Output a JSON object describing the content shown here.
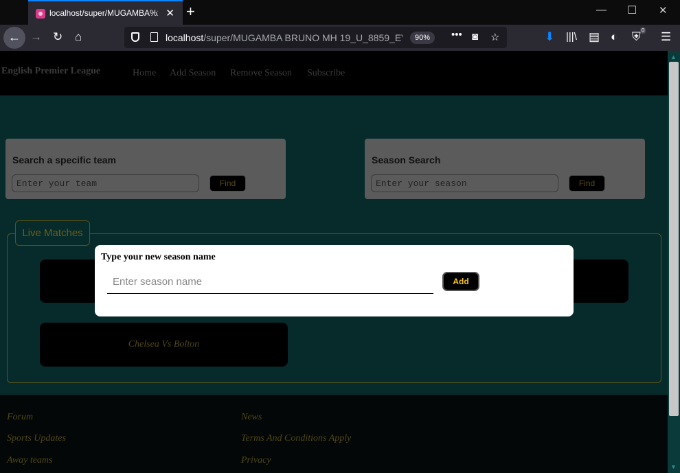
{
  "browser": {
    "tab_title": "localhost/super/MUGAMBA%2",
    "url_host": "localhost",
    "url_path": "/super/MUGAMBA BRUNO MH 19_U_8859_EV",
    "zoom": "90%",
    "badge_count": "0"
  },
  "site": {
    "brand": "English Premier League",
    "nav": [
      "Home",
      "Add Season",
      "Remove Season",
      "Subscribe"
    ]
  },
  "team_search": {
    "label": "Search a specific team",
    "placeholder": "Enter your team",
    "button": "Find"
  },
  "season_search": {
    "label": "Season Search",
    "placeholder": "Enter your season",
    "button": "Find"
  },
  "live": {
    "legend": "Live Matches",
    "matches": [
      "",
      "",
      "Chelsea Vs Bolton"
    ]
  },
  "footer": {
    "col1": [
      "Forum",
      "Sports Updates",
      "Away teams"
    ],
    "col2": [
      "News",
      "Terms And Conditions Apply",
      "Privacy"
    ]
  },
  "modal": {
    "title": "Type your new season name",
    "placeholder": "Enter season name",
    "button": "Add"
  },
  "colors": {
    "page_bg": "#072b2b",
    "accent_gold": "#f3c21a",
    "browser_blue": "#0a84ff"
  }
}
